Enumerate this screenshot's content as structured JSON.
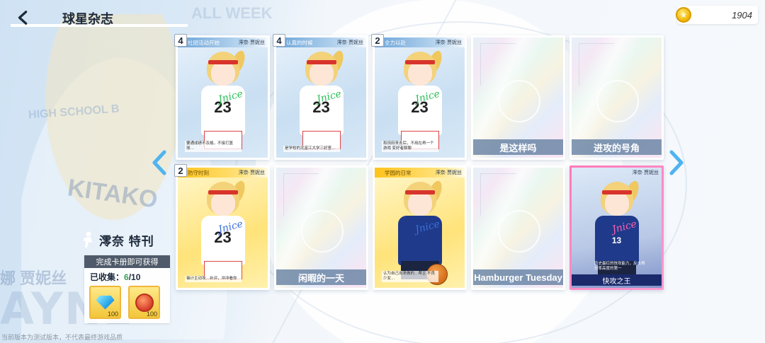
{
  "header": {
    "title": "球星杂志"
  },
  "currency": {
    "value": "1904",
    "icon": "gold-coin-icon"
  },
  "background": {
    "week_text": "ALL WEEK",
    "hs_text": "HIGH SCHOOL B",
    "jersey_text": "KITAKO",
    "name_text": "娜 贾妮丝",
    "big_text": "AYNE"
  },
  "issue": {
    "title": "澪奈 特刊",
    "reward_header": "完成卡册即可获得",
    "collected_label": "已收集：",
    "collected_count": "6",
    "collected_total": "/10",
    "rewards": [
      {
        "icon": "diamond-icon",
        "count": "100"
      },
      {
        "icon": "basketball-token-icon",
        "count": "100"
      }
    ]
  },
  "cards": [
    {
      "style": "blue",
      "count": "4",
      "header_title": "社团活动开始",
      "header_sig": "澪奈·贾妮丝",
      "jersey": "23",
      "caption": "要通成绩不及格，不接打篮球…",
      "locked": false
    },
    {
      "style": "blue",
      "count": "4",
      "header_title": "认真的时候",
      "header_sig": "澪奈·贾妮丝",
      "jersey": "23",
      "caption": "是学校的北富江大学三好室…",
      "locked": false
    },
    {
      "style": "blue",
      "count": "2",
      "header_title": "全力以赴",
      "header_sig": "澪奈·贾妮丝",
      "jersey": "23",
      "caption": "和田田来去后，不用在再一个游戏 变好者聊聊",
      "locked": false
    },
    {
      "style": "holo",
      "label": "是这样吗",
      "locked": true
    },
    {
      "style": "holo",
      "label": "进攻的号角",
      "locked": true
    },
    {
      "style": "yellow",
      "count": "2",
      "header_title": "防守时刻",
      "header_sig": "澪奈·贾妮丝",
      "jersey": "23",
      "caption": "袖计主动攻…补评，冲冲看你",
      "locked": false
    },
    {
      "style": "holo",
      "label": "闲暇的一天",
      "locked": true
    },
    {
      "style": "yellow",
      "header_title": "学园的日常",
      "header_sig": "澪奈·贾妮丝",
      "jersey": "",
      "caption": "认为自己出来做的…帮主 不良少女…",
      "locked": false,
      "navy": true
    },
    {
      "style": "holo",
      "label": "Hamburger Tuesday",
      "locked": true
    },
    {
      "style": "pink",
      "header_sig": "澪奈·贾妮丝",
      "jersey": "13",
      "caption": "历史最红的快攻能力，反击得分率高度的第一",
      "label": "快攻之王",
      "locked": false
    }
  ],
  "footer": {
    "note": "当前版本为测试版本，不代表最终游戏品质"
  }
}
